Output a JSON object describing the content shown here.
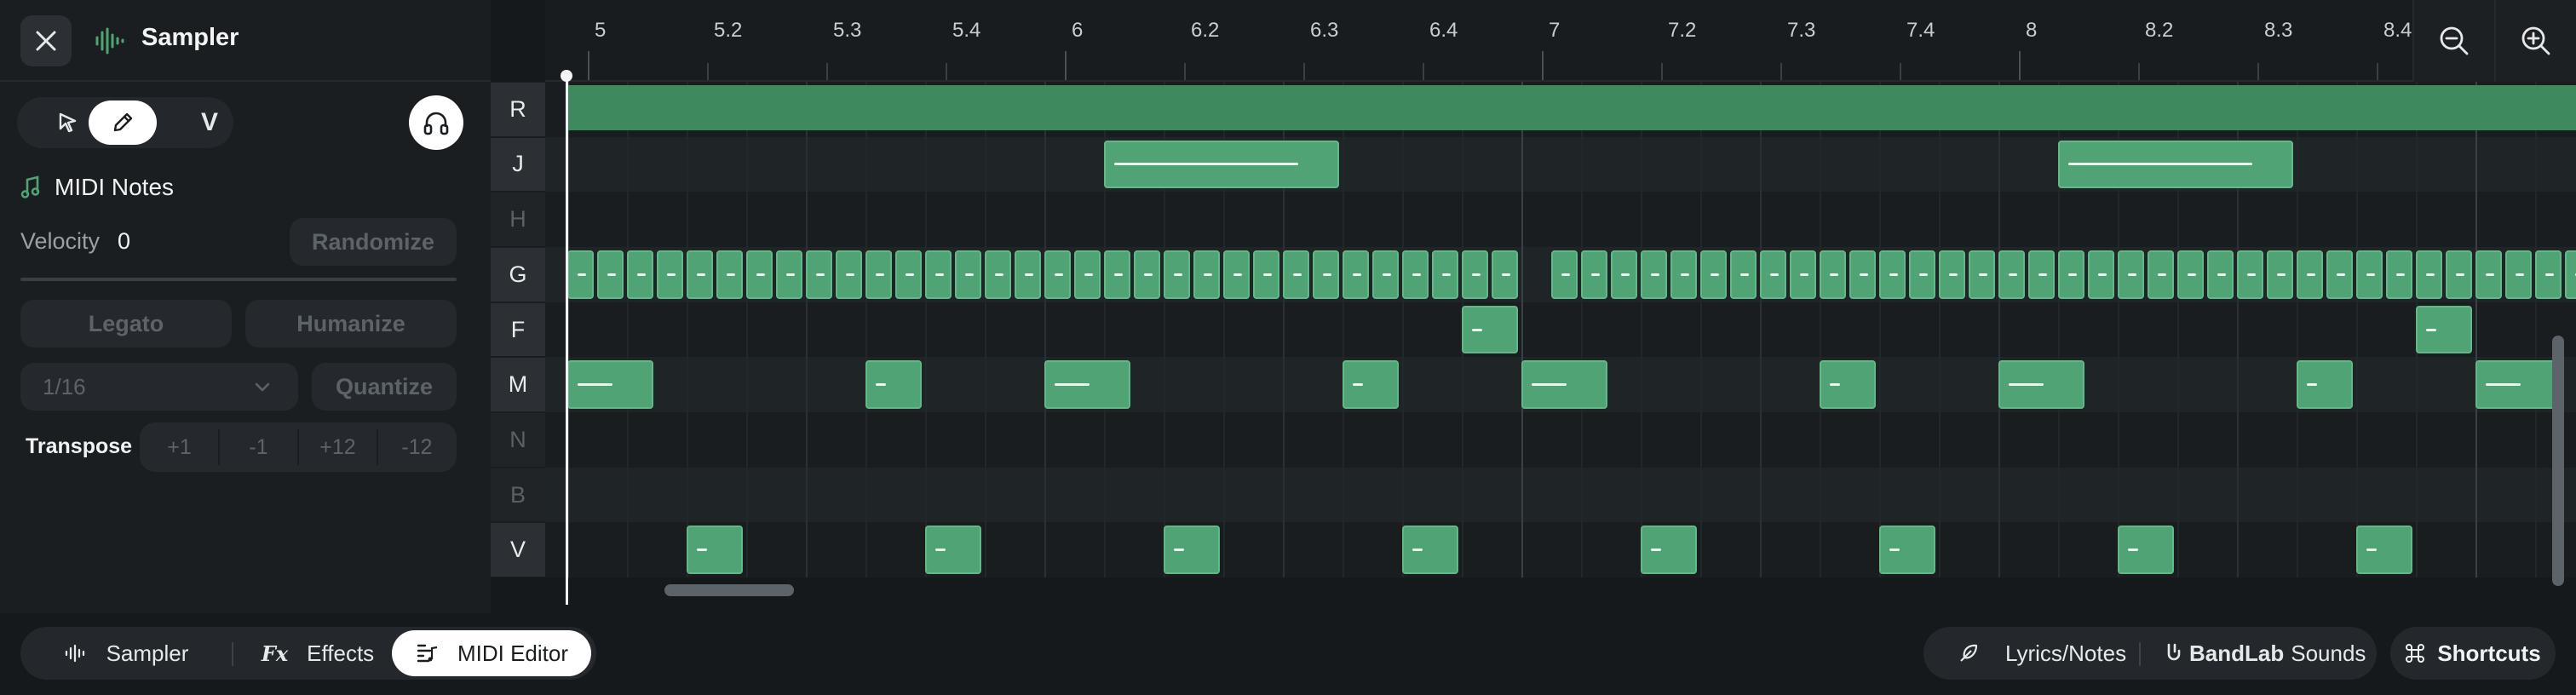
{
  "header": {
    "title": "Sampler",
    "close_icon": "close-icon",
    "instrument_icon": "waveform-icon"
  },
  "tools": {
    "select_icon": "cursor-arrow-icon",
    "pencil_icon": "pencil-icon",
    "velocity_tool_label": "V",
    "active": "pencil",
    "monitor_icon": "headphones-icon"
  },
  "section": {
    "title": "MIDI Notes",
    "icon": "music-note-icon"
  },
  "velocity": {
    "label": "Velocity",
    "value": "0",
    "randomize_label": "Randomize"
  },
  "actions": {
    "legato_label": "Legato",
    "humanize_label": "Humanize",
    "grid_value": "1/16",
    "quantize_label": "Quantize"
  },
  "transpose": {
    "label": "Transpose",
    "buttons": [
      "+1",
      "-1",
      "+12",
      "-12"
    ]
  },
  "keys": [
    {
      "label": "R",
      "lit": true
    },
    {
      "label": "J",
      "lit": true
    },
    {
      "label": "H",
      "lit": false
    },
    {
      "label": "G",
      "lit": true
    },
    {
      "label": "F",
      "lit": true
    },
    {
      "label": "M",
      "lit": true
    },
    {
      "label": "N",
      "lit": false
    },
    {
      "label": "B",
      "lit": false
    },
    {
      "label": "V",
      "lit": true
    }
  ],
  "ruler": {
    "labels": [
      "5",
      "5.2",
      "5.3",
      "5.4",
      "6",
      "6.2",
      "6.3",
      "6.4",
      "7",
      "7.2",
      "7.3",
      "7.4",
      "8",
      "8.2",
      "8.3",
      "8.4"
    ]
  },
  "zoom": {
    "out_icon": "zoom-out-icon",
    "in_icon": "zoom-in-icon"
  },
  "colors": {
    "accent": "#4fa374",
    "note_border": "#62b887",
    "loop": "#3e8a5e",
    "background": "#16191b"
  },
  "bottom": {
    "tabs": [
      {
        "label": "Sampler",
        "icon": "waveform-icon",
        "active": false
      },
      {
        "label": "Effects",
        "icon": "fx-icon",
        "active": false
      },
      {
        "label": "MIDI Editor",
        "icon": "midi-editor-icon",
        "active": true
      }
    ],
    "lyrics_label": "Lyrics/Notes",
    "sounds_brand": "BandLab",
    "sounds_label": "Sounds",
    "shortcuts_label": "Shortcuts"
  },
  "notes": [
    {
      "row": 1,
      "start": 2.25,
      "len": 1.0
    },
    {
      "row": 1,
      "start": 6.25,
      "len": 1.0
    },
    {
      "row": 4,
      "start": 3.75,
      "len": 0.25
    },
    {
      "row": 4,
      "start": 7.75,
      "len": 0.25
    },
    {
      "row": 5,
      "start": 0,
      "len": 0.375
    },
    {
      "row": 5,
      "start": 1.25,
      "len": 0.25
    },
    {
      "row": 5,
      "start": 2.0,
      "len": 0.375
    },
    {
      "row": 5,
      "start": 3.25,
      "len": 0.25
    },
    {
      "row": 5,
      "start": 4.0,
      "len": 0.375
    },
    {
      "row": 5,
      "start": 5.25,
      "len": 0.25
    },
    {
      "row": 5,
      "start": 6.0,
      "len": 0.375
    },
    {
      "row": 5,
      "start": 7.25,
      "len": 0.25
    },
    {
      "row": 5,
      "start": 8.0,
      "len": 0.375
    },
    {
      "row": 8,
      "start": 0.5,
      "len": 0.25
    },
    {
      "row": 8,
      "start": 1.5,
      "len": 0.25
    },
    {
      "row": 8,
      "start": 2.5,
      "len": 0.25
    },
    {
      "row": 8,
      "start": 3.5,
      "len": 0.25
    },
    {
      "row": 8,
      "start": 4.5,
      "len": 0.25
    },
    {
      "row": 8,
      "start": 5.5,
      "len": 0.25
    },
    {
      "row": 8,
      "start": 6.5,
      "len": 0.25
    },
    {
      "row": 8,
      "start": 7.5,
      "len": 0.25
    }
  ]
}
